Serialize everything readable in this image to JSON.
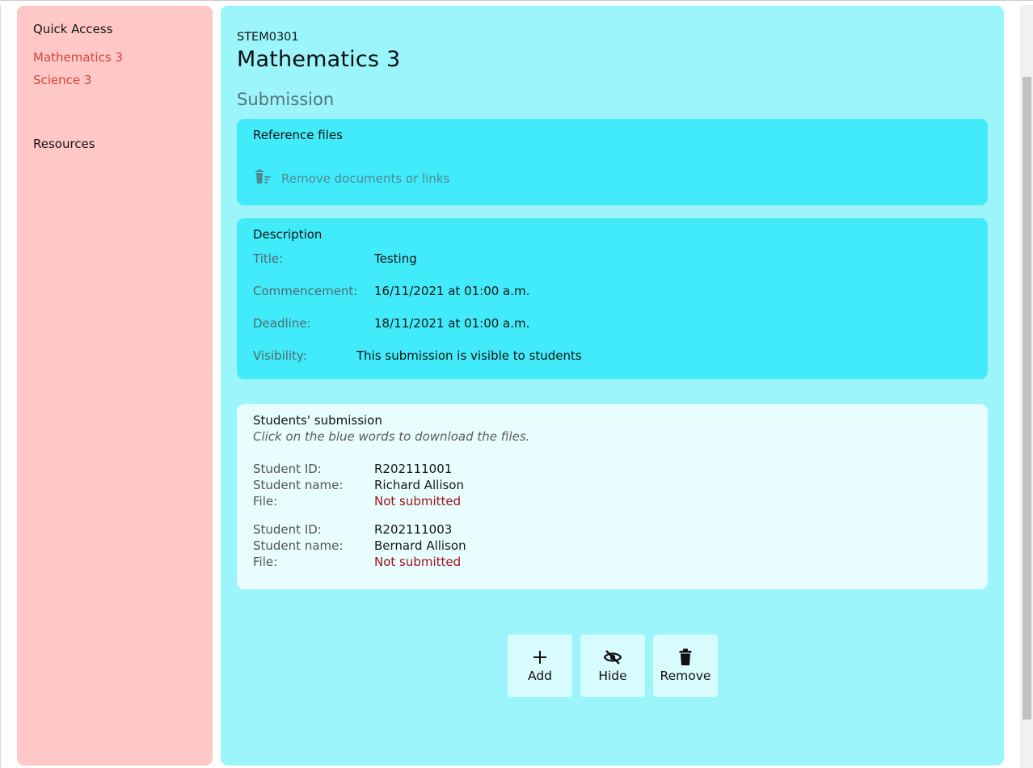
{
  "sidebar": {
    "quick_access_label": "Quick Access",
    "links": [
      "Mathematics 3",
      "Science 3"
    ],
    "resources_label": "Resources"
  },
  "course": {
    "code": "STEM0301",
    "title": "Mathematics 3"
  },
  "section_title": "Submission",
  "reference_files": {
    "title": "Reference files",
    "remove_link": "Remove documents or links"
  },
  "description": {
    "title": "Description",
    "title_label": "Title:",
    "title_value": "Testing",
    "commencement_label": "Commencement:",
    "commencement_value": "16/11/2021 at 01:00 a.m.",
    "deadline_label": "Deadline:",
    "deadline_value": "18/11/2021 at 01:00 a.m.",
    "visibility_label": "Visibility:",
    "visibility_value": "This submission is visible to students"
  },
  "students": {
    "title": "Students' submission",
    "hint": "Click on the blue words to download the files.",
    "id_label": "Student ID:",
    "name_label": "Student name:",
    "file_label": "File:",
    "entries": [
      {
        "id": "R202111001",
        "name": "Richard Allison",
        "file": "Not submitted"
      },
      {
        "id": "R202111003",
        "name": "Bernard Allison",
        "file": "Not submitted"
      }
    ]
  },
  "actions": {
    "add_label": "Add",
    "hide_label": "Hide",
    "remove_label": "Remove"
  },
  "icons": {
    "add": "plus-icon",
    "hide": "eye-slash-icon",
    "remove": "trash-icon",
    "remove_docs": "trash-list-icon"
  },
  "colors": {
    "sidebar_bg": "#ffc8c6",
    "sidebar_link": "#d3463c",
    "main_bg": "#9bf5fb",
    "card_bg": "#42ebf9",
    "students_card_bg": "#e8fdfe",
    "not_submitted": "#a0111a"
  }
}
